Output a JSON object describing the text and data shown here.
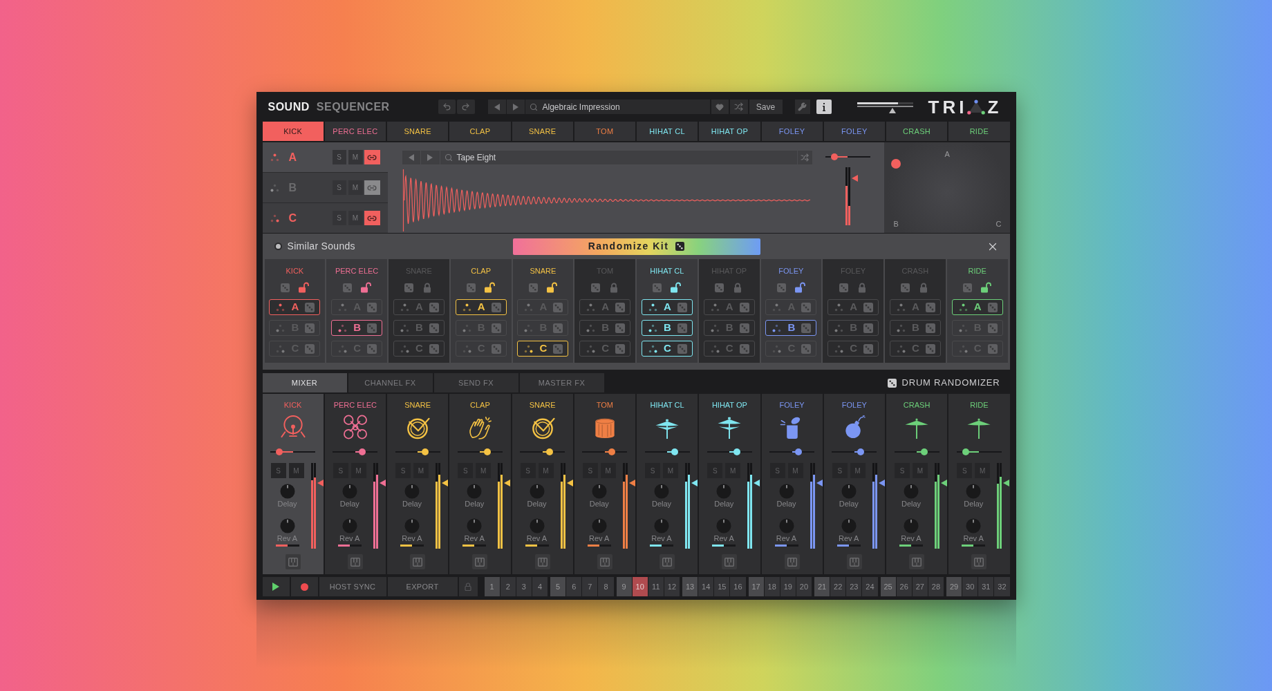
{
  "header": {
    "view_tabs": [
      {
        "label": "SOUND",
        "selected": true
      },
      {
        "label": "SEQUENCER",
        "selected": false
      }
    ],
    "preset": {
      "value": "Algebraic Impression"
    },
    "save": "Save",
    "master_volume": {
      "level": 0.63
    },
    "master_meter": {
      "level": 0.74
    },
    "logo": {
      "left": "TRI",
      "right": "Z"
    }
  },
  "instrument_tabs": [
    {
      "label": "KICK",
      "color": "#f2605e",
      "selected": true
    },
    {
      "label": "PERC ELEC",
      "color": "#ef6f94",
      "selected": false
    },
    {
      "label": "SNARE",
      "color": "#f4c244",
      "selected": false
    },
    {
      "label": "CLAP",
      "color": "#f4c244",
      "selected": false
    },
    {
      "label": "SNARE",
      "color": "#f4c244",
      "selected": false
    },
    {
      "label": "TOM",
      "color": "#ef7f45",
      "selected": false
    },
    {
      "label": "HIHAT CL",
      "color": "#7fe6f0",
      "selected": false
    },
    {
      "label": "HIHAT OP",
      "color": "#7fe6f0",
      "selected": false
    },
    {
      "label": "FOLEY",
      "color": "#7b96f3",
      "selected": false
    },
    {
      "label": "FOLEY",
      "color": "#7b96f3",
      "selected": false
    },
    {
      "label": "CRASH",
      "color": "#6dd07a",
      "selected": false
    },
    {
      "label": "RIDE",
      "color": "#6dd07a",
      "selected": false
    }
  ],
  "layers": [
    {
      "letter": "A",
      "solo_label": "S",
      "mute_label": "M",
      "selected": true,
      "linked": true
    },
    {
      "letter": "B",
      "solo_label": "S",
      "mute_label": "M",
      "selected": false,
      "linked": false
    },
    {
      "letter": "C",
      "solo_label": "S",
      "mute_label": "M",
      "selected": false,
      "linked": true
    }
  ],
  "sample": {
    "value": "Tape Eight",
    "pan": {
      "level": 0.2
    },
    "fader": {
      "level": 0.81
    },
    "meters": [
      {
        "level": 0.68
      },
      {
        "level": 0.33
      }
    ]
  },
  "xy_pad": {
    "corners": [
      "A",
      "B",
      "C"
    ]
  },
  "similar": {
    "label": "Similar Sounds",
    "on": false,
    "randomize": "Randomize Kit"
  },
  "kit_columns": [
    {
      "label": "KICK",
      "color": "#f2605e",
      "locked": false,
      "layers": [
        {
          "letter": "A",
          "selected": true
        },
        {
          "letter": "B",
          "selected": false
        },
        {
          "letter": "C",
          "selected": false
        }
      ]
    },
    {
      "label": "PERC ELEC",
      "color": "#ef6f94",
      "locked": false,
      "layers": [
        {
          "letter": "A",
          "selected": false
        },
        {
          "letter": "B",
          "selected": true
        },
        {
          "letter": "C",
          "selected": false
        }
      ]
    },
    {
      "label": "SNARE",
      "locked": true,
      "layers": [
        {
          "letter": "A",
          "selected": false
        },
        {
          "letter": "B",
          "selected": false
        },
        {
          "letter": "C",
          "selected": false
        }
      ]
    },
    {
      "label": "CLAP",
      "color": "#f4c244",
      "locked": false,
      "layers": [
        {
          "letter": "A",
          "selected": true
        },
        {
          "letter": "B",
          "selected": false
        },
        {
          "letter": "C",
          "selected": false
        }
      ]
    },
    {
      "label": "SNARE",
      "color": "#f4c244",
      "locked": false,
      "layers": [
        {
          "letter": "A",
          "selected": false
        },
        {
          "letter": "B",
          "selected": false
        },
        {
          "letter": "C",
          "selected": true
        }
      ]
    },
    {
      "label": "TOM",
      "locked": true,
      "layers": [
        {
          "letter": "A",
          "selected": false
        },
        {
          "letter": "B",
          "selected": false
        },
        {
          "letter": "C",
          "selected": false
        }
      ]
    },
    {
      "label": "HIHAT CL",
      "color": "#7fe6f0",
      "locked": false,
      "layers": [
        {
          "letter": "A",
          "selected": true
        },
        {
          "letter": "B",
          "selected": true
        },
        {
          "letter": "C",
          "selected": true
        }
      ]
    },
    {
      "label": "HIHAT OP",
      "locked": true,
      "layers": [
        {
          "letter": "A",
          "selected": false
        },
        {
          "letter": "B",
          "selected": false
        },
        {
          "letter": "C",
          "selected": false
        }
      ]
    },
    {
      "label": "FOLEY",
      "color": "#7b96f3",
      "locked": false,
      "layers": [
        {
          "letter": "A",
          "selected": false
        },
        {
          "letter": "B",
          "selected": true
        },
        {
          "letter": "C",
          "selected": false
        }
      ]
    },
    {
      "label": "FOLEY",
      "locked": true,
      "layers": [
        {
          "letter": "A",
          "selected": false
        },
        {
          "letter": "B",
          "selected": false
        },
        {
          "letter": "C",
          "selected": false
        }
      ]
    },
    {
      "label": "CRASH",
      "locked": true,
      "layers": [
        {
          "letter": "A",
          "selected": false
        },
        {
          "letter": "B",
          "selected": false
        },
        {
          "letter": "C",
          "selected": false
        }
      ]
    },
    {
      "label": "RIDE",
      "color": "#6dd07a",
      "locked": false,
      "layers": [
        {
          "letter": "A",
          "selected": true
        },
        {
          "letter": "B",
          "selected": false
        },
        {
          "letter": "C",
          "selected": false
        }
      ]
    }
  ],
  "mixer": {
    "tabs": [
      {
        "label": "MIXER",
        "selected": true
      },
      {
        "label": "CHANNEL FX",
        "selected": false
      },
      {
        "label": "SEND FX",
        "selected": false
      },
      {
        "label": "MASTER FX",
        "selected": false
      }
    ],
    "randomizer": "DRUM RANDOMIZER",
    "strips": [
      {
        "label": "KICK",
        "color": "#f2605e",
        "kind": "kick",
        "selected": true,
        "pan": {
          "level": 0.2
        },
        "solo_label": "S",
        "mute_label": "M",
        "delay": {
          "label": "Delay",
          "level": 0.5
        },
        "rev_a": {
          "label": "Rev A",
          "level": 0.5
        },
        "fader": {
          "level": 0.77
        },
        "meters": [
          {
            "level": 0.8
          },
          {
            "level": 0.83
          }
        ]
      },
      {
        "label": "PERC ELEC",
        "color": "#ef6f94",
        "kind": "perc",
        "selected": false,
        "pan": {
          "level": 0.66
        },
        "solo_label": "S",
        "mute_label": "M",
        "delay": {
          "label": "Delay",
          "level": 0.5
        },
        "rev_a": {
          "label": "Rev A",
          "level": 0.5
        },
        "fader": {
          "level": 0.77
        },
        "meters": [
          {
            "level": 0.78
          },
          {
            "level": 0.86
          }
        ]
      },
      {
        "label": "SNARE",
        "color": "#f4c244",
        "kind": "snare",
        "selected": false,
        "pan": {
          "level": 0.66
        },
        "solo_label": "S",
        "mute_label": "M",
        "delay": {
          "label": "Delay",
          "level": 0.5
        },
        "rev_a": {
          "label": "Rev A",
          "level": 0.5
        },
        "fader": {
          "level": 0.77
        },
        "meters": [
          {
            "level": 0.78
          },
          {
            "level": 0.86
          }
        ]
      },
      {
        "label": "CLAP",
        "color": "#f4c244",
        "kind": "clap",
        "selected": false,
        "pan": {
          "level": 0.66
        },
        "solo_label": "S",
        "mute_label": "M",
        "delay": {
          "label": "Delay",
          "level": 0.5
        },
        "rev_a": {
          "label": "Rev A",
          "level": 0.5
        },
        "fader": {
          "level": 0.77
        },
        "meters": [
          {
            "level": 0.78
          },
          {
            "level": 0.86
          }
        ]
      },
      {
        "label": "SNARE",
        "color": "#f4c244",
        "kind": "snare",
        "selected": false,
        "pan": {
          "level": 0.66
        },
        "solo_label": "S",
        "mute_label": "M",
        "delay": {
          "label": "Delay",
          "level": 0.5
        },
        "rev_a": {
          "label": "Rev A",
          "level": 0.5
        },
        "fader": {
          "level": 0.77
        },
        "meters": [
          {
            "level": 0.78
          },
          {
            "level": 0.86
          }
        ]
      },
      {
        "label": "TOM",
        "color": "#ef7f45",
        "kind": "tom",
        "selected": false,
        "pan": {
          "level": 0.66
        },
        "solo_label": "S",
        "mute_label": "M",
        "delay": {
          "label": "Delay",
          "level": 0.5
        },
        "rev_a": {
          "label": "Rev A",
          "level": 0.5
        },
        "fader": {
          "level": 0.77
        },
        "meters": [
          {
            "level": 0.78
          },
          {
            "level": 0.86
          }
        ]
      },
      {
        "label": "HIHAT CL",
        "color": "#7fe6f0",
        "kind": "hihat_closed",
        "selected": false,
        "pan": {
          "level": 0.66
        },
        "solo_label": "S",
        "mute_label": "M",
        "delay": {
          "label": "Delay",
          "level": 0.5
        },
        "rev_a": {
          "label": "Rev A",
          "level": 0.5
        },
        "fader": {
          "level": 0.77
        },
        "meters": [
          {
            "level": 0.78
          },
          {
            "level": 0.86
          }
        ]
      },
      {
        "label": "HIHAT OP",
        "color": "#7fe6f0",
        "kind": "hihat_open",
        "selected": false,
        "pan": {
          "level": 0.66
        },
        "solo_label": "S",
        "mute_label": "M",
        "delay": {
          "label": "Delay",
          "level": 0.5
        },
        "rev_a": {
          "label": "Rev A",
          "level": 0.5
        },
        "fader": {
          "level": 0.77
        },
        "meters": [
          {
            "level": 0.78
          },
          {
            "level": 0.86
          }
        ]
      },
      {
        "label": "FOLEY",
        "color": "#7b96f3",
        "kind": "can",
        "selected": false,
        "pan": {
          "level": 0.64
        },
        "solo_label": "S",
        "mute_label": "M",
        "delay": {
          "label": "Delay",
          "level": 0.5
        },
        "rev_a": {
          "label": "Rev A",
          "level": 0.5
        },
        "fader": {
          "level": 0.77
        },
        "meters": [
          {
            "level": 0.78
          },
          {
            "level": 0.86
          }
        ]
      },
      {
        "label": "FOLEY",
        "color": "#7b96f3",
        "kind": "bomb",
        "selected": false,
        "pan": {
          "level": 0.64
        },
        "solo_label": "S",
        "mute_label": "M",
        "delay": {
          "label": "Delay",
          "level": 0.5
        },
        "rev_a": {
          "label": "Rev A",
          "level": 0.5
        },
        "fader": {
          "level": 0.77
        },
        "meters": [
          {
            "level": 0.78
          },
          {
            "level": 0.86
          }
        ]
      },
      {
        "label": "CRASH",
        "color": "#6dd07a",
        "kind": "cymbal",
        "selected": false,
        "pan": {
          "level": 0.66
        },
        "solo_label": "S",
        "mute_label": "M",
        "delay": {
          "label": "Delay",
          "level": 0.5
        },
        "rev_a": {
          "label": "Rev A",
          "level": 0.5
        },
        "fader": {
          "level": 0.77
        },
        "meters": [
          {
            "level": 0.78
          },
          {
            "level": 0.86
          }
        ]
      },
      {
        "label": "RIDE",
        "color": "#6dd07a",
        "kind": "cymbal",
        "selected": false,
        "pan": {
          "level": 0.2
        },
        "solo_label": "S",
        "mute_label": "M",
        "delay": {
          "label": "Delay",
          "level": 0.5
        },
        "rev_a": {
          "label": "Rev A",
          "level": 0.5
        },
        "fader": {
          "level": 0.77
        },
        "meters": [
          {
            "level": 0.76
          },
          {
            "level": 0.84
          }
        ]
      }
    ]
  },
  "transport": {
    "host_sync": "HOST SYNC",
    "export": "EXPORT",
    "steps": [
      {
        "label": "1",
        "selected": false
      },
      {
        "label": "2",
        "selected": false
      },
      {
        "label": "3",
        "selected": false
      },
      {
        "label": "4",
        "selected": false
      },
      {
        "label": "5",
        "selected": false
      },
      {
        "label": "6",
        "selected": false
      },
      {
        "label": "7",
        "selected": false
      },
      {
        "label": "8",
        "selected": false
      },
      {
        "label": "9",
        "selected": false
      },
      {
        "label": "10",
        "selected": true
      },
      {
        "label": "11",
        "selected": false
      },
      {
        "label": "12",
        "selected": false
      },
      {
        "label": "13",
        "selected": false
      },
      {
        "label": "14",
        "selected": false
      },
      {
        "label": "15",
        "selected": false
      },
      {
        "label": "16",
        "selected": false
      },
      {
        "label": "17",
        "selected": false
      },
      {
        "label": "18",
        "selected": false
      },
      {
        "label": "19",
        "selected": false
      },
      {
        "label": "20",
        "selected": false
      },
      {
        "label": "21",
        "selected": false
      },
      {
        "label": "22",
        "selected": false
      },
      {
        "label": "23",
        "selected": false
      },
      {
        "label": "24",
        "selected": false
      },
      {
        "label": "25",
        "selected": false
      },
      {
        "label": "26",
        "selected": false
      },
      {
        "label": "27",
        "selected": false
      },
      {
        "label": "28",
        "selected": false
      },
      {
        "label": "29",
        "selected": false
      },
      {
        "label": "30",
        "selected": false
      },
      {
        "label": "31",
        "selected": false
      },
      {
        "label": "32",
        "selected": false
      }
    ]
  }
}
